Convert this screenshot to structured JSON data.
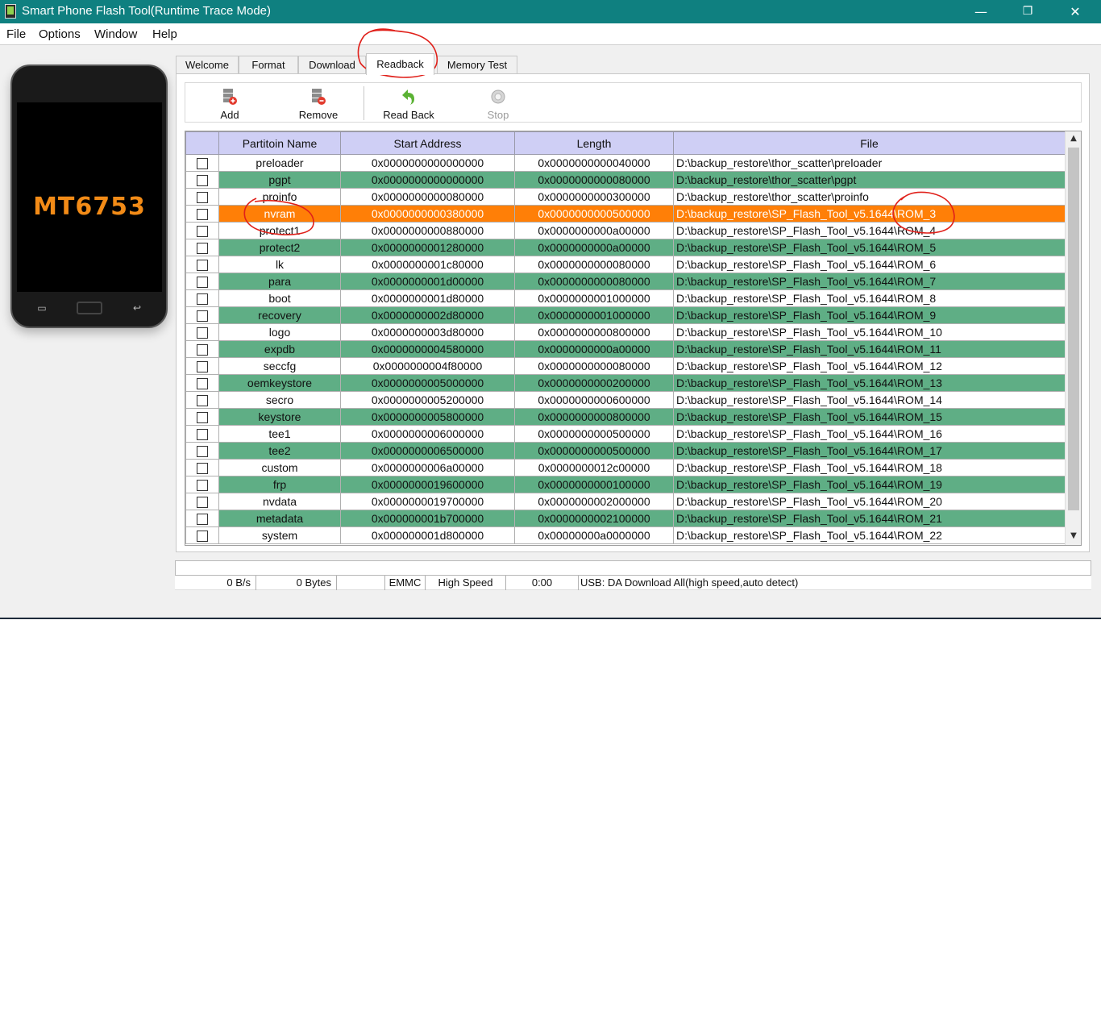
{
  "window": {
    "title": "Smart Phone Flash Tool(Runtime Trace Mode)",
    "controls": {
      "minimize": "—",
      "restore": "❐",
      "close": "✕"
    }
  },
  "menu": [
    "File",
    "Options",
    "Window",
    "Help"
  ],
  "device": {
    "chip": "MT6753"
  },
  "tabs": [
    "Welcome",
    "Format",
    "Download",
    "Readback",
    "Memory Test"
  ],
  "active_tab": "Readback",
  "toolbar": {
    "add": "Add",
    "remove": "Remove",
    "read_back": "Read Back",
    "stop": "Stop"
  },
  "table": {
    "columns": [
      "",
      "Partitoin Name",
      "Start Address",
      "Length",
      "File"
    ],
    "selected_index": 3,
    "rows": [
      {
        "name": "preloader",
        "start": "0x0000000000000000",
        "length": "0x0000000000040000",
        "file": "D:\\backup_restore\\thor_scatter\\preloader"
      },
      {
        "name": "pgpt",
        "start": "0x0000000000000000",
        "length": "0x0000000000080000",
        "file": "D:\\backup_restore\\thor_scatter\\pgpt"
      },
      {
        "name": "proinfo",
        "start": "0x0000000000080000",
        "length": "0x0000000000300000",
        "file": "D:\\backup_restore\\thor_scatter\\proinfo"
      },
      {
        "name": "nvram",
        "start": "0x0000000000380000",
        "length": "0x0000000000500000",
        "file": "D:\\backup_restore\\SP_Flash_Tool_v5.1644\\ROM_3"
      },
      {
        "name": "protect1",
        "start": "0x0000000000880000",
        "length": "0x0000000000a00000",
        "file": "D:\\backup_restore\\SP_Flash_Tool_v5.1644\\ROM_4"
      },
      {
        "name": "protect2",
        "start": "0x0000000001280000",
        "length": "0x0000000000a00000",
        "file": "D:\\backup_restore\\SP_Flash_Tool_v5.1644\\ROM_5"
      },
      {
        "name": "lk",
        "start": "0x0000000001c80000",
        "length": "0x0000000000080000",
        "file": "D:\\backup_restore\\SP_Flash_Tool_v5.1644\\ROM_6"
      },
      {
        "name": "para",
        "start": "0x0000000001d00000",
        "length": "0x0000000000080000",
        "file": "D:\\backup_restore\\SP_Flash_Tool_v5.1644\\ROM_7"
      },
      {
        "name": "boot",
        "start": "0x0000000001d80000",
        "length": "0x0000000001000000",
        "file": "D:\\backup_restore\\SP_Flash_Tool_v5.1644\\ROM_8"
      },
      {
        "name": "recovery",
        "start": "0x0000000002d80000",
        "length": "0x0000000001000000",
        "file": "D:\\backup_restore\\SP_Flash_Tool_v5.1644\\ROM_9"
      },
      {
        "name": "logo",
        "start": "0x0000000003d80000",
        "length": "0x0000000000800000",
        "file": "D:\\backup_restore\\SP_Flash_Tool_v5.1644\\ROM_10"
      },
      {
        "name": "expdb",
        "start": "0x0000000004580000",
        "length": "0x0000000000a00000",
        "file": "D:\\backup_restore\\SP_Flash_Tool_v5.1644\\ROM_11"
      },
      {
        "name": "seccfg",
        "start": "0x0000000004f80000",
        "length": "0x0000000000080000",
        "file": "D:\\backup_restore\\SP_Flash_Tool_v5.1644\\ROM_12"
      },
      {
        "name": "oemkeystore",
        "start": "0x0000000005000000",
        "length": "0x0000000000200000",
        "file": "D:\\backup_restore\\SP_Flash_Tool_v5.1644\\ROM_13"
      },
      {
        "name": "secro",
        "start": "0x0000000005200000",
        "length": "0x0000000000600000",
        "file": "D:\\backup_restore\\SP_Flash_Tool_v5.1644\\ROM_14"
      },
      {
        "name": "keystore",
        "start": "0x0000000005800000",
        "length": "0x0000000000800000",
        "file": "D:\\backup_restore\\SP_Flash_Tool_v5.1644\\ROM_15"
      },
      {
        "name": "tee1",
        "start": "0x0000000006000000",
        "length": "0x0000000000500000",
        "file": "D:\\backup_restore\\SP_Flash_Tool_v5.1644\\ROM_16"
      },
      {
        "name": "tee2",
        "start": "0x0000000006500000",
        "length": "0x0000000000500000",
        "file": "D:\\backup_restore\\SP_Flash_Tool_v5.1644\\ROM_17"
      },
      {
        "name": "custom",
        "start": "0x0000000006a00000",
        "length": "0x0000000012c00000",
        "file": "D:\\backup_restore\\SP_Flash_Tool_v5.1644\\ROM_18"
      },
      {
        "name": "frp",
        "start": "0x0000000019600000",
        "length": "0x0000000000100000",
        "file": "D:\\backup_restore\\SP_Flash_Tool_v5.1644\\ROM_19"
      },
      {
        "name": "nvdata",
        "start": "0x0000000019700000",
        "length": "0x0000000002000000",
        "file": "D:\\backup_restore\\SP_Flash_Tool_v5.1644\\ROM_20"
      },
      {
        "name": "metadata",
        "start": "0x000000001b700000",
        "length": "0x0000000002100000",
        "file": "D:\\backup_restore\\SP_Flash_Tool_v5.1644\\ROM_21"
      },
      {
        "name": "system",
        "start": "0x000000001d800000",
        "length": "0x00000000a0000000",
        "file": "D:\\backup_restore\\SP_Flash_Tool_v5.1644\\ROM_22"
      }
    ]
  },
  "status": {
    "speed": "0 B/s",
    "bytes": "0 Bytes",
    "storage": "EMMC",
    "mode": "High Speed",
    "time": "0:00",
    "connection": "USB: DA Download All(high speed,auto detect)"
  },
  "colors": {
    "titlebar": "#0f8080",
    "row_alt": "#5fae85",
    "row_selected": "#ff7f07",
    "header": "#cfcff5",
    "annotation": "#e0201a"
  }
}
